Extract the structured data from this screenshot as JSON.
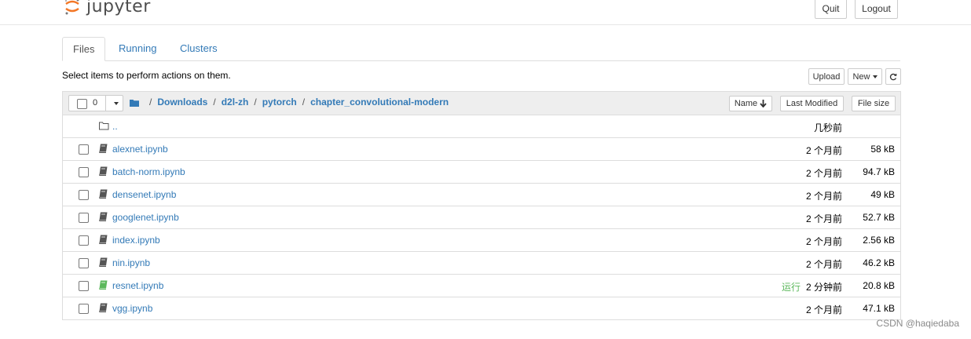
{
  "app": {
    "logo_text": "jupyter"
  },
  "header": {
    "quit_label": "Quit",
    "logout_label": "Logout"
  },
  "tabs": [
    {
      "label": "Files",
      "active": true
    },
    {
      "label": "Running",
      "active": false
    },
    {
      "label": "Clusters",
      "active": false
    }
  ],
  "toolbar": {
    "hint": "Select items to perform actions on them.",
    "upload_label": "Upload",
    "new_label": "New",
    "refresh_icon": "refresh-icon"
  },
  "list_header": {
    "selected_count": "0",
    "breadcrumb": [
      "Downloads",
      "d2l-zh",
      "pytorch",
      "chapter_convolutional-modern"
    ],
    "breadcrumb_sep": "/",
    "sort_name_label": "Name",
    "sort_modified_label": "Last Modified",
    "sort_size_label": "File size"
  },
  "parent_row": {
    "name": "..",
    "modified": "几秒前"
  },
  "files": [
    {
      "name": "alexnet.ipynb",
      "status": "",
      "modified": "2 个月前",
      "size": "58 kB",
      "running": false
    },
    {
      "name": "batch-norm.ipynb",
      "status": "",
      "modified": "2 个月前",
      "size": "94.7 kB",
      "running": false
    },
    {
      "name": "densenet.ipynb",
      "status": "",
      "modified": "2 个月前",
      "size": "49 kB",
      "running": false
    },
    {
      "name": "googlenet.ipynb",
      "status": "",
      "modified": "2 个月前",
      "size": "52.7 kB",
      "running": false
    },
    {
      "name": "index.ipynb",
      "status": "",
      "modified": "2 个月前",
      "size": "2.56 kB",
      "running": false
    },
    {
      "name": "nin.ipynb",
      "status": "",
      "modified": "2 个月前",
      "size": "46.2 kB",
      "running": false
    },
    {
      "name": "resnet.ipynb",
      "status": "运行",
      "modified": "2 分钟前",
      "size": "20.8 kB",
      "running": true
    },
    {
      "name": "vgg.ipynb",
      "status": "",
      "modified": "2 个月前",
      "size": "47.1 kB",
      "running": false
    }
  ],
  "colors": {
    "link": "#337ab7",
    "running": "#5cb85c",
    "notebook_icon": "#555555",
    "logo_orange": "#f37726"
  },
  "watermark": "CSDN @haqiedaba"
}
